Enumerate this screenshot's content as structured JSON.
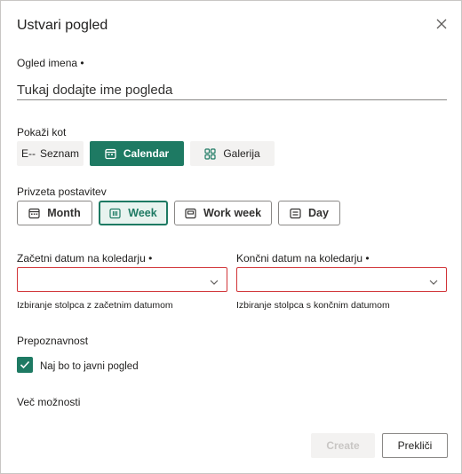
{
  "dialog": {
    "title": "Ustvari pogled",
    "close_icon": "close-icon"
  },
  "view_name": {
    "label": "Ogled imena •",
    "placeholder": "Tukaj dodajte ime pogleda",
    "value": ""
  },
  "show_as": {
    "label": "Pokaži kot",
    "options": [
      {
        "label": "Seznam",
        "icon": "list-icon",
        "selected": false
      },
      {
        "label": "Calendar",
        "icon": "calendar-icon",
        "selected": true
      },
      {
        "label": "Galerija",
        "icon": "gallery-icon",
        "selected": false
      }
    ]
  },
  "default_layout": {
    "label": "Privzeta postavitev",
    "options": [
      {
        "label": "Month",
        "icon": "calendar-month-icon",
        "selected": false
      },
      {
        "label": "Week",
        "icon": "calendar-week-icon",
        "selected": true
      },
      {
        "label": "Work week",
        "icon": "calendar-workweek-icon",
        "selected": false
      },
      {
        "label": "Day",
        "icon": "calendar-day-icon",
        "selected": false
      }
    ]
  },
  "start_date": {
    "label": "Začetni datum na koledarju •",
    "value": "",
    "helper": "Izbiranje stolpca z začetnim datumom"
  },
  "end_date": {
    "label": "Končni datum na koledarju •",
    "value": "",
    "helper": "Izbiranje stolpca s končnim datumom"
  },
  "visibility": {
    "label": "Prepoznavnost",
    "checkbox_label": "Naj bo to javni pogled",
    "checked": true
  },
  "more_options": "Več možnosti",
  "footer": {
    "create_label": "Create",
    "cancel_label": "Prekliči"
  },
  "colors": {
    "accent": "#1e7a63",
    "error_border": "#d13438"
  }
}
